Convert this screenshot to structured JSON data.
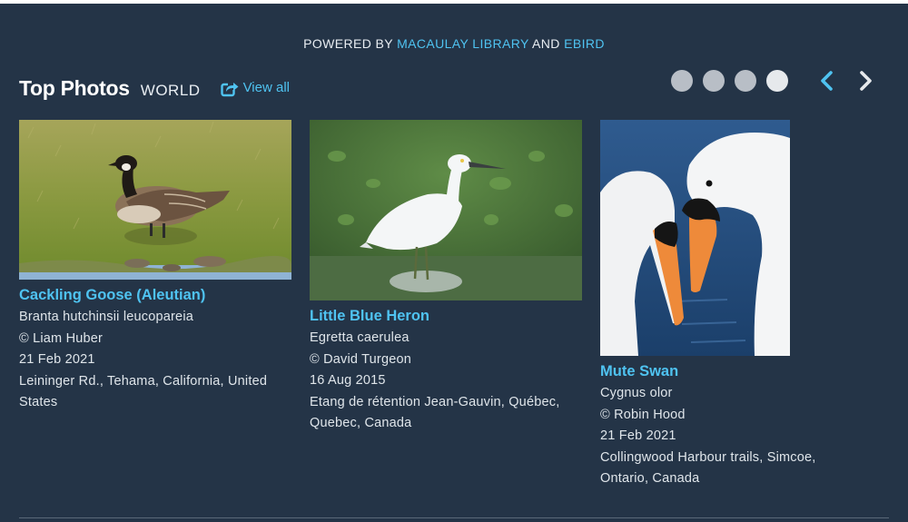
{
  "powered": {
    "prefix": "POWERED BY",
    "macaulay": "MACAULAY LIBRARY",
    "and": "AND",
    "ebird": "EBIRD"
  },
  "header": {
    "title": "Top Photos",
    "region": "WORLD",
    "view_all": "View all"
  },
  "carousel": {
    "pages": 4,
    "active_page": 4
  },
  "photos": [
    {
      "common": "Cackling Goose (Aleutian)",
      "scientific": "Branta hutchinsii leucopareia",
      "credit": "© Liam Huber",
      "date": "21 Feb 2021",
      "location": "Leininger Rd., Tehama, California, United States"
    },
    {
      "common": "Little Blue Heron",
      "scientific": "Egretta caerulea",
      "credit": "© David Turgeon",
      "date": "16 Aug 2015",
      "location": "Etang de rétention Jean-Gauvin, Québec, Quebec, Canada"
    },
    {
      "common": "Mute Swan",
      "scientific": "Cygnus olor",
      "credit": "© Robin Hood",
      "date": "21 Feb 2021",
      "location": "Collingwood Harbour trails, Simcoe, Ontario, Canada"
    }
  ],
  "colors": {
    "panel": "#243447",
    "accent": "#4fc3f1",
    "dot": "#b8bec6",
    "dot_active": "#e6e9ec"
  }
}
